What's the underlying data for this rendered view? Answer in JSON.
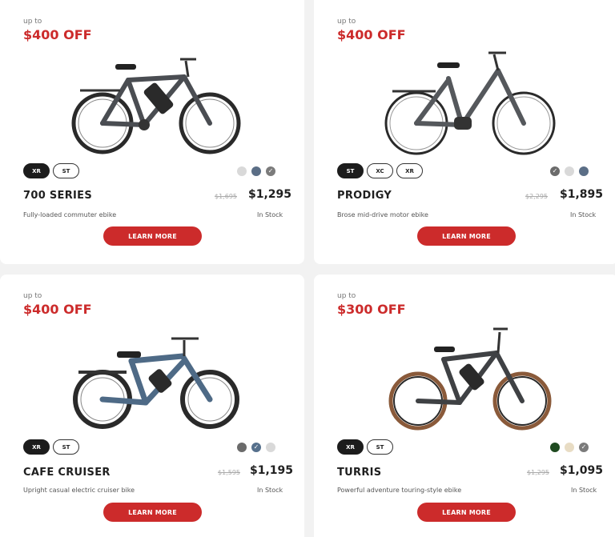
{
  "cards": [
    {
      "upto": "up to",
      "discount": "$400 OFF",
      "sizes": [
        "XR",
        "ST"
      ],
      "name": "700 SERIES",
      "old_price": "$1,695",
      "price": "$1,295",
      "description": "Fully-loaded commuter ebike",
      "stock": "In Stock",
      "button": "LEARN MORE",
      "frame_color": "#4a4d52"
    },
    {
      "upto": "up to",
      "discount": "$400 OFF",
      "sizes": [
        "ST",
        "XC",
        "XR"
      ],
      "name": "PRODIGY",
      "old_price": "$2,295",
      "price": "$1,895",
      "description": "Brose mid-drive motor ebike",
      "stock": "In Stock",
      "button": "LEARN MORE",
      "frame_color": "#55585c"
    },
    {
      "upto": "up to",
      "discount": "$400 OFF",
      "sizes": [
        "XR",
        "ST"
      ],
      "name": "CAFE CRUISER",
      "old_price": "$1,595",
      "price": "$1,195",
      "description": "Upright casual electric cruiser bike",
      "stock": "In Stock",
      "button": "LEARN MORE",
      "frame_color": "#4e6a86"
    },
    {
      "upto": "up to",
      "discount": "$300 OFF",
      "sizes": [
        "XR",
        "ST"
      ],
      "name": "TURRIS",
      "old_price": "$1,295",
      "price": "$1,095",
      "description": "Powerful adventure touring-style ebike",
      "stock": "In Stock",
      "button": "LEARN MORE",
      "frame_color": "#3f4144"
    }
  ],
  "swatch_colors": {
    "c0": [
      "#d9d9d9",
      "#5b6e86",
      "#7b7b7b"
    ],
    "c1": [
      "#6b6b6b",
      "#d9d9d9",
      "#5b6e86"
    ],
    "c2": [
      "#6b6b6b",
      "#56708c",
      "#d9d9d9"
    ],
    "c3": [
      "#1f4a20",
      "#e8dcc4",
      "#7b7b7b"
    ]
  },
  "accent_color": "#cc2b2b"
}
